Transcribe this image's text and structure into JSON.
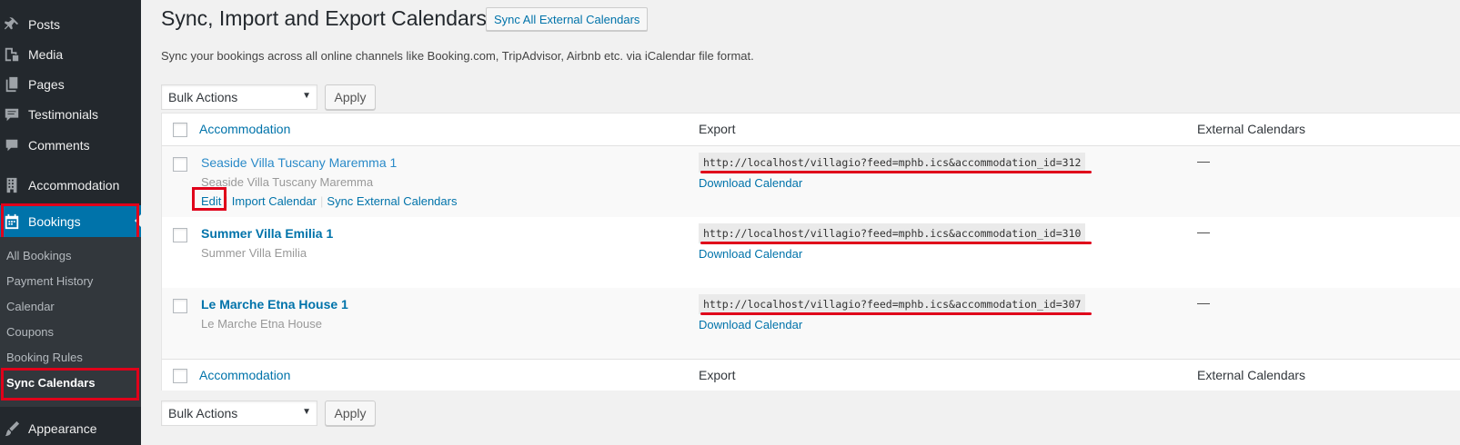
{
  "sidebar": {
    "top_items": [
      {
        "label": "Posts",
        "icon": "pin-icon"
      },
      {
        "label": "Media",
        "icon": "media-icon"
      },
      {
        "label": "Pages",
        "icon": "pages-icon"
      },
      {
        "label": "Testimonials",
        "icon": "testimonial-icon"
      },
      {
        "label": "Comments",
        "icon": "comment-icon"
      },
      {
        "label": "Accommodation",
        "icon": "building-icon"
      }
    ],
    "active_item": {
      "label": "Bookings",
      "icon": "calendar-icon"
    },
    "submenu": [
      "All Bookings",
      "Payment History",
      "Calendar",
      "Coupons",
      "Booking Rules",
      "Sync Calendars"
    ],
    "bottom_item": {
      "label": "Appearance",
      "icon": "brush-icon"
    }
  },
  "header": {
    "title": "Sync, Import and Export Calendars",
    "action_button": "Sync All External Calendars",
    "description": "Sync your bookings across all online channels like Booking.com, TripAdvisor, Airbnb etc. via iCalendar file format."
  },
  "bulk": {
    "select_label": "Bulk Actions",
    "apply_label": "Apply"
  },
  "table": {
    "columns": {
      "accommodation": "Accommodation",
      "export": "Export",
      "external": "External Calendars"
    },
    "rows": [
      {
        "title": "Seaside Villa Tuscany Maremma 1",
        "subtitle": "Seaside Villa Tuscany Maremma",
        "url": "http://localhost/villagio?feed=mphb.ics&accommodation_id=312",
        "download": "Download Calendar",
        "external": "—",
        "actions": {
          "edit": "Edit",
          "import": "Import Calendar",
          "sync": "Sync External Calendars"
        }
      },
      {
        "title": "Summer Villa Emilia 1",
        "subtitle": "Summer Villa Emilia",
        "url": "http://localhost/villagio?feed=mphb.ics&accommodation_id=310",
        "download": "Download Calendar",
        "external": "—"
      },
      {
        "title": "Le Marche Etna House 1",
        "subtitle": "Le Marche Etna House",
        "url": "http://localhost/villagio?feed=mphb.ics&accommodation_id=307",
        "download": "Download Calendar",
        "external": "—"
      }
    ]
  },
  "colors": {
    "sidebar_bg": "#23282d",
    "active_bg": "#0073aa",
    "link": "#0073aa",
    "highlight": "#e0001a"
  }
}
